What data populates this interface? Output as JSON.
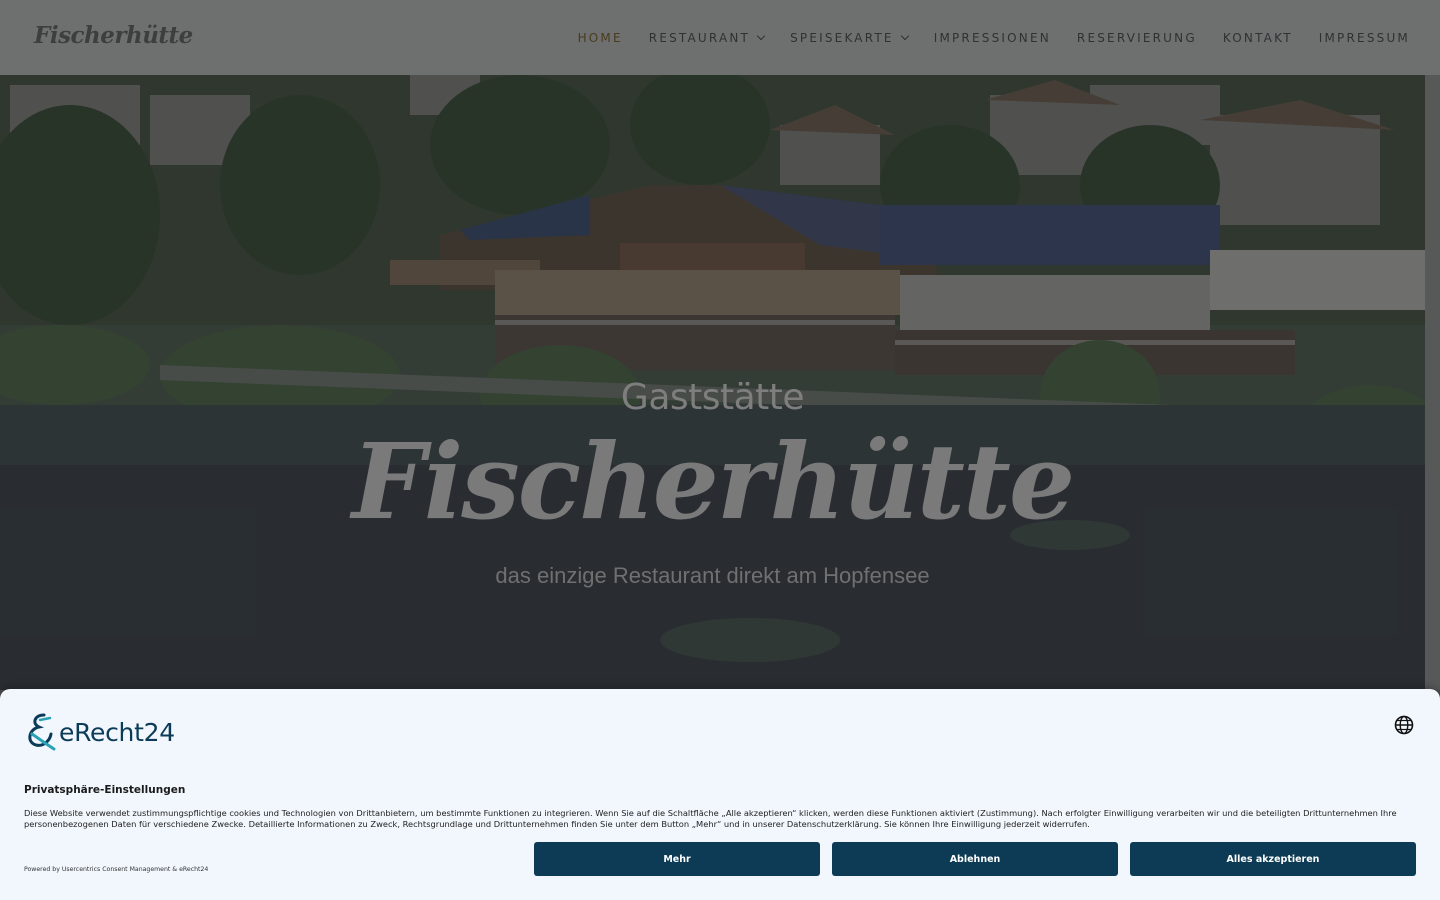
{
  "header": {
    "logo": "Fischerhütte",
    "nav": [
      {
        "label": "HOME",
        "active": true,
        "dropdown": false
      },
      {
        "label": "RESTAURANT",
        "active": false,
        "dropdown": true
      },
      {
        "label": "SPEISEKARTE",
        "active": false,
        "dropdown": true
      },
      {
        "label": "IMPRESSIONEN",
        "active": false,
        "dropdown": false
      },
      {
        "label": "RESERVIERUNG",
        "active": false,
        "dropdown": false
      },
      {
        "label": "KONTAKT",
        "active": false,
        "dropdown": false
      },
      {
        "label": "IMPRESSUM",
        "active": false,
        "dropdown": false
      }
    ]
  },
  "hero": {
    "kicker": "Gaststätte",
    "title": "Fischerhütte",
    "tagline": "das einzige Restaurant direkt am Hopfensee"
  },
  "consent": {
    "brand": "eRecht24",
    "language_icon": "globe-icon",
    "title": "Privatsphäre-Einstellungen",
    "body": "Diese Website verwendet zustimmungspflichtige cookies und Technologien von Drittanbietern, um bestimmte Funktionen zu integrieren. Wenn Sie auf die Schaltfläche „Alle akzeptieren“ klicken, werden diese Funktionen aktiviert (Zustimmung). Nach erfolgter Einwilligung verarbeiten wir und die beteiligten Drittunternehmen Ihre personenbezogenen Daten für verschiedene Zwecke. Detaillierte Informationen zu Zweck, Rechtsgrundlage und Drittunternehmen finden Sie unter dem Button „Mehr“ und in unserer Datenschutzerklärung. Sie können Ihre Einwilligung jederzeit widerrufen.",
    "powered_by": "Powered by Usercentrics Consent Management & eRecht24",
    "buttons": {
      "more": "Mehr",
      "deny": "Ablehnen",
      "accept_all": "Alles akzeptieren"
    }
  },
  "colors": {
    "header_bg": "#6e7070",
    "consent_bg": "#f1f7fd",
    "button_bg": "#0d3b55",
    "brand": "#0c3b57"
  }
}
